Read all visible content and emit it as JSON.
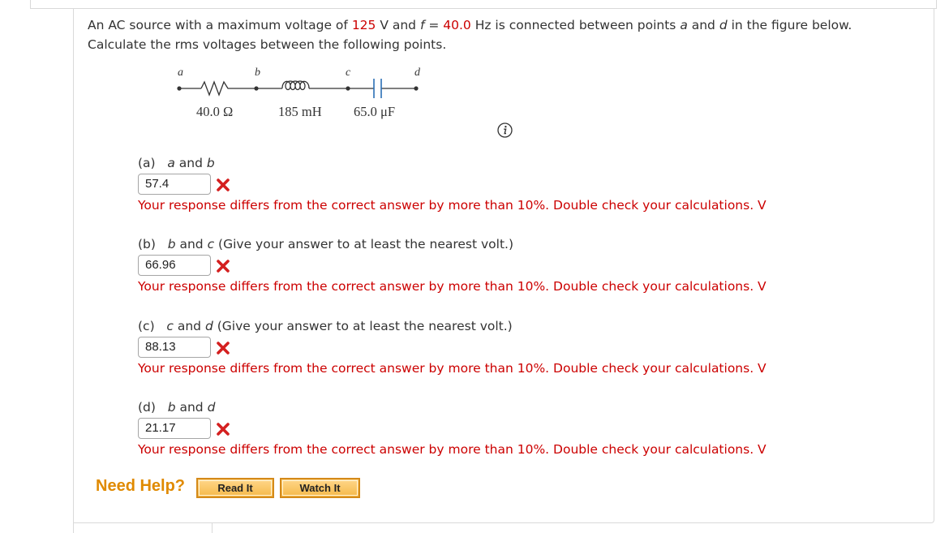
{
  "intro": {
    "t1": "An AC source with a maximum voltage of ",
    "vmax": "125",
    "t2": " V and ",
    "fvar": "f",
    "t3": " = ",
    "freq": "40.0",
    "t4": " Hz is connected between points ",
    "pa": "a",
    "t5": " and ",
    "pd": "d",
    "t6": " in the figure below.",
    "line2": "Calculate the rms voltages between the following points."
  },
  "circuit": {
    "points": [
      "a",
      "b",
      "c",
      "d"
    ],
    "resistor": "40.0 Ω",
    "inductor": "185 mH",
    "capacitor": "65.0 μF"
  },
  "parts": [
    {
      "tag": "(a)",
      "p1": "a",
      "mid": " and ",
      "p2": "b",
      "note": "",
      "value": "57.4",
      "feedback": "Your response differs from the correct answer by more than 10%. Double check your calculations. V"
    },
    {
      "tag": "(b)",
      "p1": "b",
      "mid": " and ",
      "p2": "c",
      "note": " (Give your answer to at least the nearest volt.)",
      "value": "66.96",
      "feedback": "Your response differs from the correct answer by more than 10%. Double check your calculations. V"
    },
    {
      "tag": "(c)",
      "p1": "c",
      "mid": " and ",
      "p2": "d",
      "note": " (Give your answer to at least the nearest volt.)",
      "value": "88.13",
      "feedback": "Your response differs from the correct answer by more than 10%. Double check your calculations. V"
    },
    {
      "tag": "(d)",
      "p1": "b",
      "mid": " and ",
      "p2": "d",
      "note": "",
      "value": "21.17",
      "feedback": "Your response differs from the correct answer by more than 10%. Double check your calculations. V"
    }
  ],
  "help": {
    "label": "Need Help?",
    "read_it": "Read It",
    "watch_it": "Watch It"
  },
  "icons": {
    "info": "info-icon",
    "incorrect": "red-x-icon"
  },
  "colors": {
    "error": "#cc0000",
    "help": "#e08a00",
    "capacitor": "#2a6fb5"
  }
}
